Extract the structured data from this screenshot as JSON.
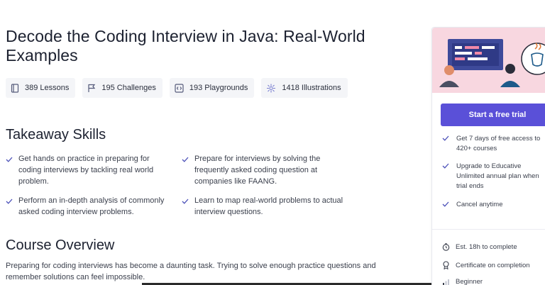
{
  "course": {
    "title": "Decode the Coding Interview in Java: Real-World Examples"
  },
  "stats": [
    {
      "icon": "lessons-icon",
      "label": "389 Lessons"
    },
    {
      "icon": "challenges-flag-icon",
      "label": "195 Challenges"
    },
    {
      "icon": "playground-icon",
      "label": "193 Playgrounds"
    },
    {
      "icon": "illustrations-icon",
      "label": "1418 Illustrations"
    }
  ],
  "takeaway": {
    "heading": "Takeaway Skills",
    "skills": [
      "Get hands on practice in preparing for coding interviews by tackling real world problem.",
      "Prepare for interviews by solving the frequently asked coding question at companies like FAANG.",
      "Perform an in-depth analysis of commonly asked coding interview problems.",
      "Learn to map real-world problems to actual interview questions."
    ]
  },
  "overview": {
    "heading": "Course Overview",
    "text": "Preparing for coding interviews has become a daunting task. Trying to solve enough practice questions and remember solutions can feel impossible."
  },
  "sidebar": {
    "cta_label": "Start a free trial",
    "perks": [
      "Get 7 days of free access to 420+ courses",
      "Upgrade to Educative Unlimited annual plan when trial ends",
      "Cancel anytime"
    ],
    "meta": [
      {
        "icon": "clock-icon",
        "label": "Est. 18h to complete"
      },
      {
        "icon": "certificate-icon",
        "label": "Certificate on completion"
      },
      {
        "icon": "level-icon",
        "label": "Beginner"
      }
    ]
  },
  "colors": {
    "accent": "#5a50d8",
    "check": "#4a4fb8",
    "banner_bg": "#f8d7e0"
  }
}
